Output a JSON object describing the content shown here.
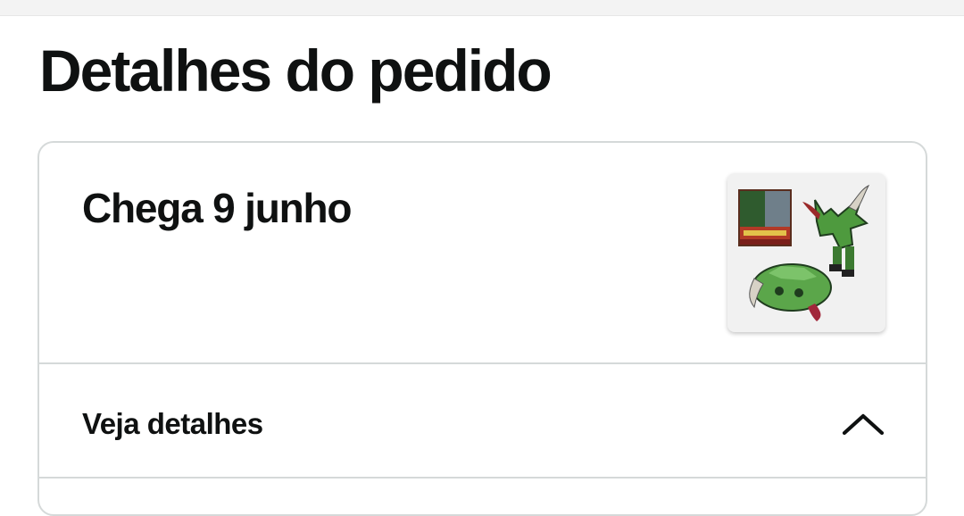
{
  "page": {
    "title": "Detalhes do pedido"
  },
  "order": {
    "arrival": "Chega 9 junho",
    "product_image_icon": "transformers-toy-product-image",
    "details_toggle_label": "Veja detalhes",
    "details_expanded": true,
    "chevron_icon": "chevron-up-icon"
  },
  "colors": {
    "text": "#0f1111",
    "border": "#d5d9d9",
    "top_strip": "#f3f3f3"
  }
}
